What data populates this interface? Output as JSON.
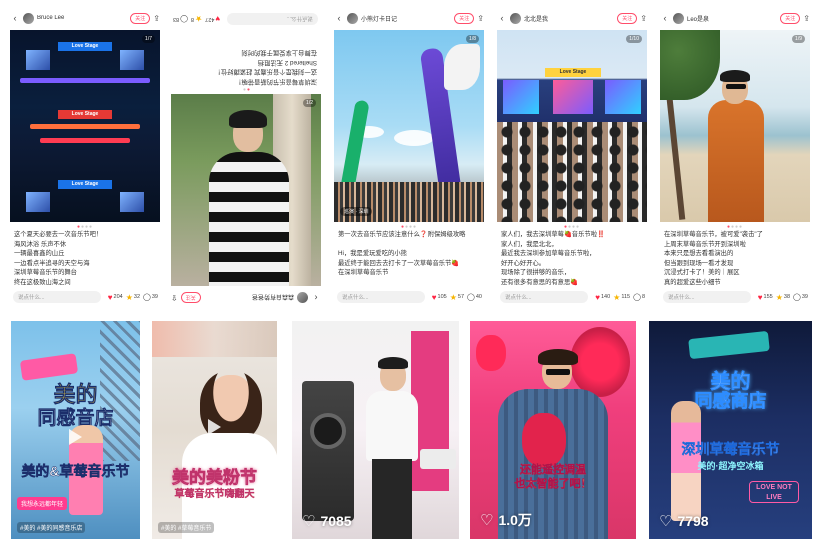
{
  "posts": [
    {
      "user": "Bruce Lee",
      "follow": "关注",
      "photo_count": "1/7",
      "photo_signs": [
        "Love Stage",
        "Love Stage",
        "Love Stage"
      ],
      "text": "这个夏天必要去一次音乐节吧！\n海风沐浴 乐声不休\n一辆最喜鑫的山丘\n一边看点半追寻的天空与海\n深圳草莓音乐节的舞台\n终在这极致山海之间",
      "comment_placeholder": "说点什么...",
      "likes": "204",
      "stars": "32",
      "comments": "39",
      "flipped": false
    },
    {
      "user": "森森自有势爸爸",
      "follow": "关注",
      "photo_count": "1/2",
      "text": "深圳草莓音乐节的新晋带嘛！\n这一刻我是个音乐嘉宾 赶紧蹲好位！\nSheltered 2 无法阻挡\n在舞台上享受属于我的时刻",
      "comment_placeholder": "说点什么...",
      "likes": "427",
      "stars": "8",
      "comments": "83",
      "flipped": true
    },
    {
      "user": "小熊灯卡日记",
      "follow": "关注",
      "photo_count": "1/8",
      "tag": "巡演 · 深圳",
      "text": "第一次去音乐节应该注意什么❓附保姆级攻略\n\nHi，我是爱玩爱吃的小熊\n最近终于能回去去打卡了一次草莓音乐节🍓\n在深圳草莓音乐节",
      "comment_placeholder": "说点什么...",
      "likes": "105",
      "stars": "57",
      "comments": "40",
      "flipped": false
    },
    {
      "user": "北北是我",
      "follow": "关注",
      "photo_count": "1/10",
      "photo_sign": "Love Stage",
      "text": "家人们，我去深圳草莓🍓音乐节啦‼️\n家人们，我是北北，\n最近我去深圳参加草莓音乐节啦，\n好开心好开心。\n现场除了很拼够的音乐，\n还有很多有意思的有意思🍓",
      "comment_placeholder": "说点什么...",
      "likes": "140",
      "stars": "115",
      "comments": "8",
      "flipped": false
    },
    {
      "user": "Leo是泉",
      "follow": "关注",
      "photo_count": "1/9",
      "text": "在深圳草莓音乐节，被可爱\"袭击\"了\n上周末草莓音乐节开到深圳啦\n本来只是想去看看演出的\n但当跟到现场一看才发现\n沉浸式打卡了！美的｜展区\n真的超爱这些小细节",
      "comment_placeholder": "说点什么...",
      "likes": "155",
      "stars": "38",
      "comments": "39",
      "flipped": false
    }
  ],
  "videos": [
    {
      "headline_1": "美的",
      "headline_2": "同感音店",
      "title": "美的&草莓音乐节",
      "badge": "我想永远都年轻",
      "tagline": "#美的 #美的同感音乐店"
    },
    {
      "title": "美的美粉节",
      "subtitle": "草莓音乐节嗨翻天",
      "tagline": "#美的 #草莓音乐节"
    },
    {
      "likes": "7085"
    },
    {
      "caption_1": "还能遥控调温",
      "caption_2": "也太智能了吧！",
      "likes": "1.0万"
    },
    {
      "headline_1": "美的",
      "headline_2": "同感商店",
      "title": "深圳草莓音乐节",
      "subtitle": "美的·超净空冰箱",
      "sign": "LOVE NOT LIVE",
      "likes": "7798"
    }
  ],
  "colors": {
    "accent": "#ff2442",
    "star": "#f7b500",
    "follow_border": "#ff4d6a"
  }
}
